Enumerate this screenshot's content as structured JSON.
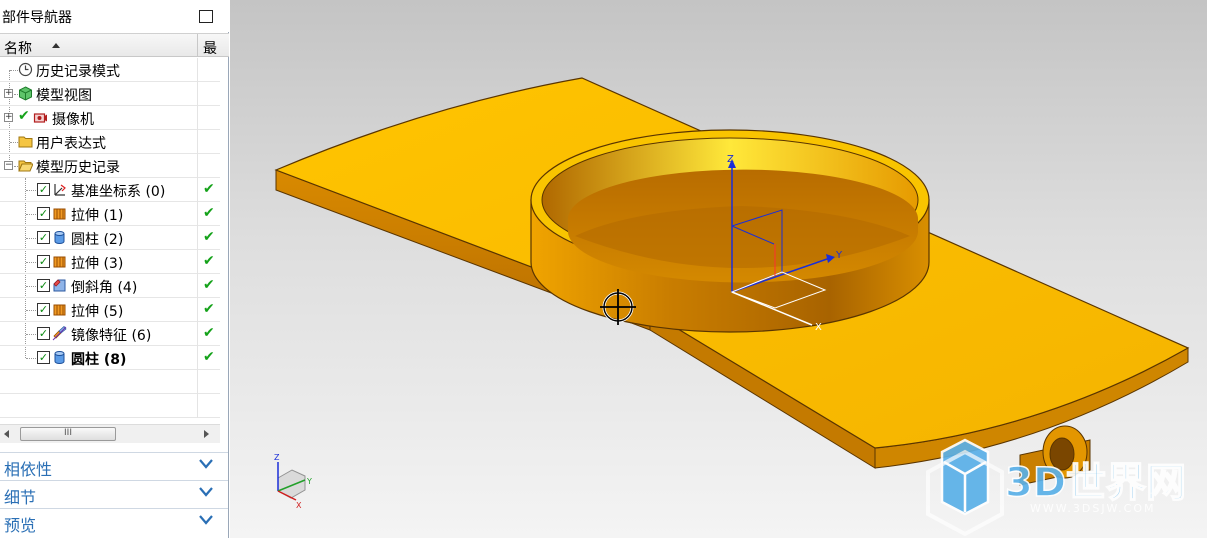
{
  "navigator": {
    "title": "部件导航器",
    "columns": {
      "name": "名称",
      "latest": "最"
    },
    "items": [
      {
        "label": "历史记录模式",
        "icon": "clock-icon"
      },
      {
        "label": "模型视图",
        "icon": "model-views-icon"
      },
      {
        "label": "摄像机",
        "icon": "camera-icon"
      },
      {
        "label": "用户表达式",
        "icon": "folder-icon"
      },
      {
        "label": "模型历史记录",
        "icon": "folder-open-icon"
      },
      {
        "label": "基准坐标系 (0)",
        "icon": "datum-csys-icon"
      },
      {
        "label": "拉伸 (1)",
        "icon": "extrude-icon"
      },
      {
        "label": "圆柱 (2)",
        "icon": "cylinder-icon"
      },
      {
        "label": "拉伸 (3)",
        "icon": "extrude-icon"
      },
      {
        "label": "倒斜角 (4)",
        "icon": "chamfer-icon"
      },
      {
        "label": "拉伸 (5)",
        "icon": "extrude-icon"
      },
      {
        "label": "镜像特征 (6)",
        "icon": "mirror-feature-icon"
      },
      {
        "label": "圆柱 (8)",
        "icon": "cylinder-icon"
      }
    ],
    "latest_mark": "✔",
    "scroll_thumb": "III"
  },
  "sections": {
    "dependencies": "相依性",
    "details": "细节",
    "preview": "预览"
  },
  "viewport": {
    "axes": {
      "x": "X",
      "y": "Y",
      "z": "Z"
    },
    "model_color": "#f5b400",
    "watermark": {
      "text": "3D世界网",
      "url": "WWW.3DSJW.COM"
    }
  },
  "colors": {
    "accent": "#2a6fb5",
    "check": "#15a21a"
  }
}
